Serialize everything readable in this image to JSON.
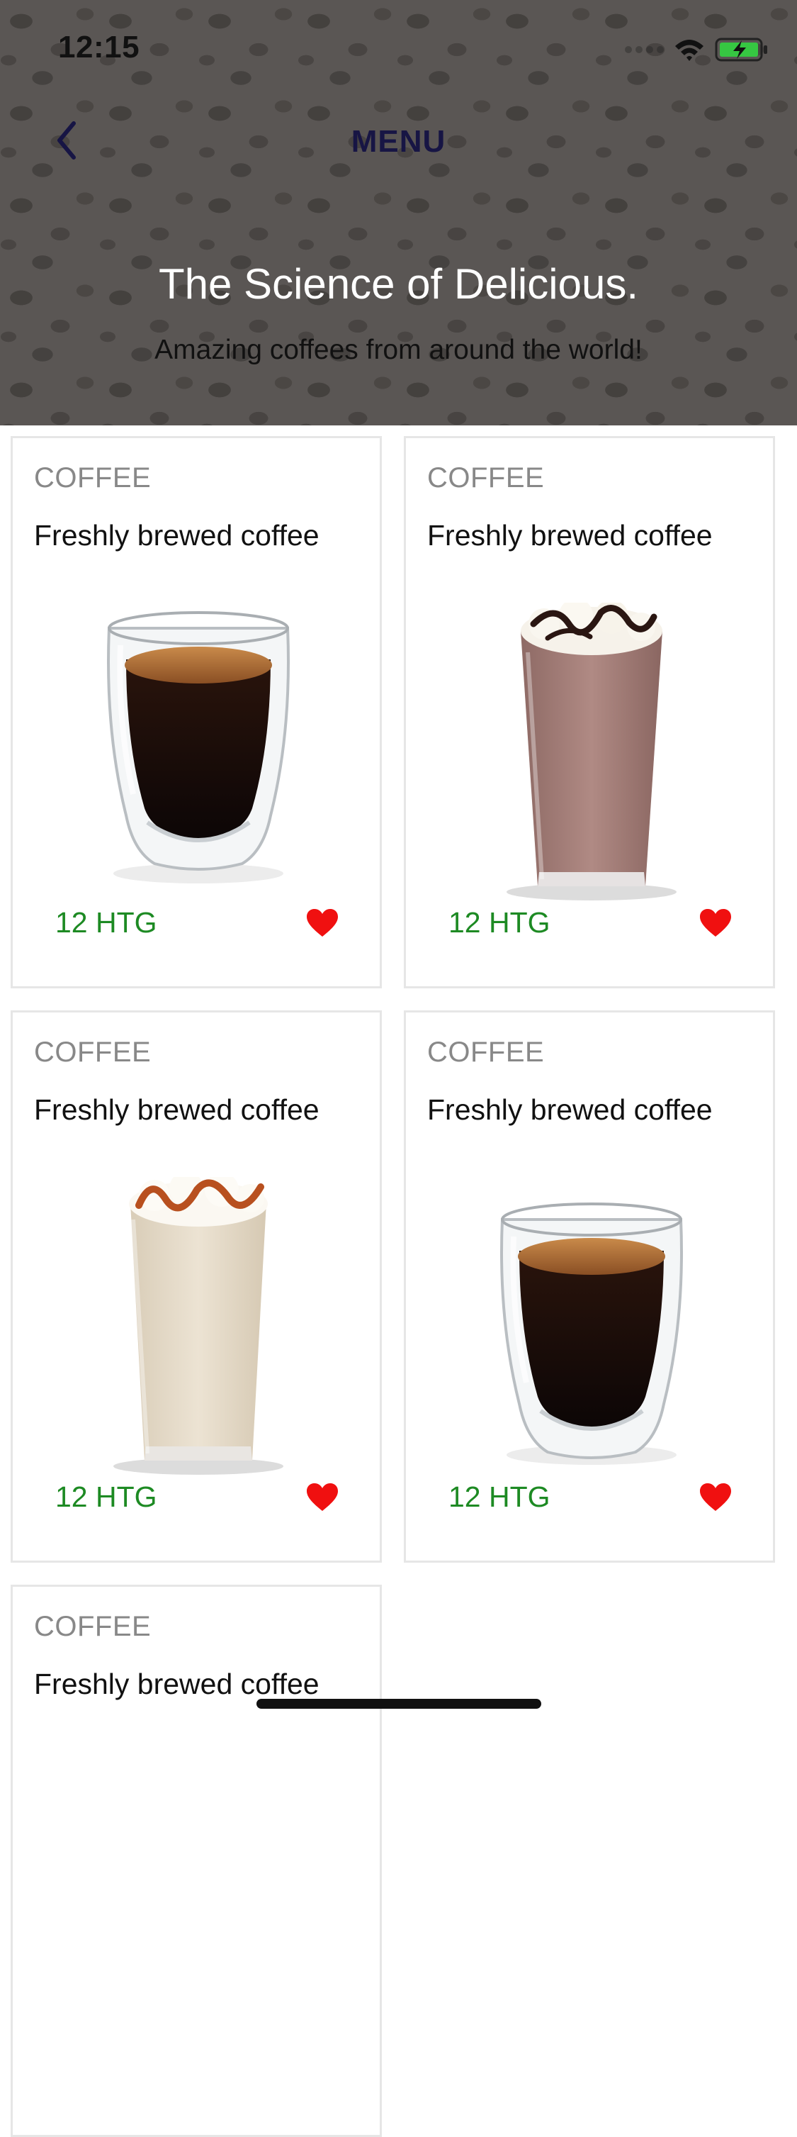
{
  "status_bar": {
    "time": "12:15",
    "icons": [
      "signal-dots-icon",
      "wifi-icon",
      "battery-charging-icon"
    ],
    "battery_color": "#36c742"
  },
  "header": {
    "back_icon": "chevron-left-icon",
    "title": "MENU",
    "headline": "The Science of Delicious.",
    "subheadline": "Amazing coffees from around the world!"
  },
  "products": [
    {
      "category": "COFFEE",
      "description": "Freshly brewed coffee",
      "price": "12 HTG",
      "favorite": true,
      "image": "espresso-glass"
    },
    {
      "category": "COFFEE",
      "description": "Freshly brewed coffee",
      "price": "12 HTG",
      "favorite": true,
      "image": "chocolate-frappe"
    },
    {
      "category": "COFFEE",
      "description": "Freshly brewed coffee",
      "price": "12 HTG",
      "favorite": true,
      "image": "caramel-frappe"
    },
    {
      "category": "COFFEE",
      "description": "Freshly brewed coffee",
      "price": "12 HTG",
      "favorite": true,
      "image": "espresso-glass"
    },
    {
      "category": "COFFEE",
      "description": "Freshly brewed coffee"
    }
  ],
  "colors": {
    "title": "#171544",
    "price": "#1d8a23",
    "heart": "#f01010",
    "card_border": "#e6e6e6"
  }
}
